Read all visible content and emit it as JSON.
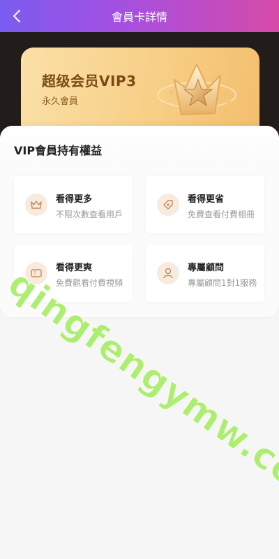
{
  "header": {
    "title": "會員卡詳情"
  },
  "vip_card": {
    "title": "超级会员VIP3",
    "subtitle": "永久會員"
  },
  "benefits_section": {
    "title": "VIP會員持有權益",
    "items": [
      {
        "title": "看得更多",
        "desc": "不限次數查看用戶",
        "icon": "crown-icon"
      },
      {
        "title": "看得更省",
        "desc": "免費查看付費相冊",
        "icon": "tag-icon"
      },
      {
        "title": "看得更爽",
        "desc": "免費觀看付費視頻",
        "icon": "ticket-icon"
      },
      {
        "title": "專屬顧問",
        "desc": "專屬顧問1對1服務",
        "icon": "advisor-icon"
      }
    ]
  },
  "watermark": "qingfengymw.com",
  "colors": {
    "header_start": "#7b5cf0",
    "header_end": "#d64aa9",
    "card_gold": "#f7cf86",
    "card_text": "#7a4a16",
    "icon_bg": "#f7ebe0",
    "icon_stroke": "#c58a56"
  }
}
